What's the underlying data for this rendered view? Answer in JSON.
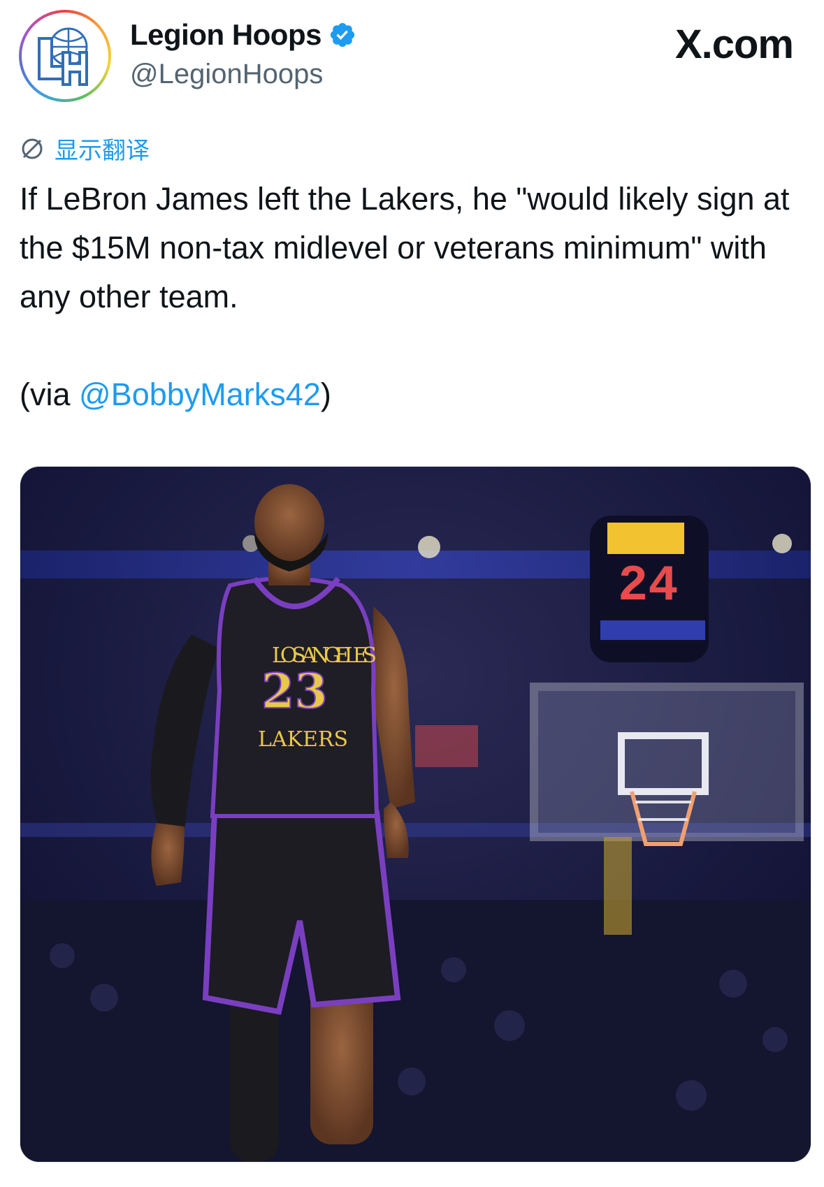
{
  "author": {
    "name": "Legion Hoops",
    "handle": "@LegionHoops",
    "verified": true,
    "avatar_letters": "LH"
  },
  "brand": "X.com",
  "translate_label": "显示翻译",
  "tweet": {
    "text": "If LeBron James left the Lakers, he \"would likely sign at the $15M non-tax midlevel or veterans minimum\" with any other team.",
    "via_prefix": "(via ",
    "via_mention": "@BobbyMarks42",
    "via_suffix": ")"
  },
  "media": {
    "jersey_team": "LAKERS",
    "jersey_number": "23",
    "jersey_city": "LOS ANGELES",
    "shot_clock": "24"
  },
  "colors": {
    "link": "#1d9bf0",
    "verified": "#1d9bf0",
    "text": "#0f1419",
    "secondary": "#536471"
  }
}
